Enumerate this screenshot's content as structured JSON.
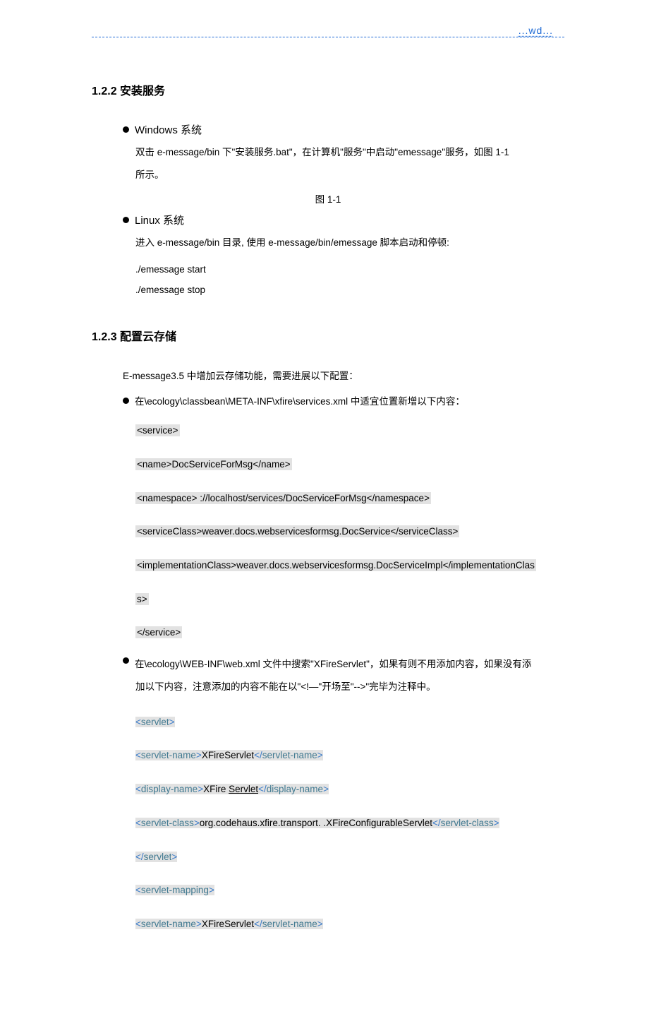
{
  "header": {
    "text": "...wd..."
  },
  "sec1": {
    "heading": "1.2.2 安装服务",
    "win": {
      "title": "Windows 系统",
      "p1": "双击 e-message/bin 下\"安装服务.bat\"，在计算机\"服务\"中启动\"emessage\"服务，如图 1-1",
      "p2": "所示。",
      "fig": "图 1-1"
    },
    "linux": {
      "title": "Linux 系统",
      "p1": "进入 e-message/bin 目录, 使用 e-message/bin/emessage 脚本启动和停顿:",
      "c1": "./emessage   start",
      "c2": "./emessage   stop"
    }
  },
  "sec2": {
    "heading": "1.2.3 配置云存储",
    "intro": "E-message3.5 中增加云存储功能，需要进展以下配置：",
    "bullet1": "在\\ecology\\classbean\\META-INF\\xfire\\services.xml 中适宜位置新增以下内容：",
    "svc": {
      "open": "<service>",
      "name": "  <name>DocServiceForMsg</name>",
      "ns": "  <namespace>       ://localhost/services/DocServiceForMsg</namespace>",
      "scls": "  <serviceClass>weaver.docs.webservicesformsg.DocService</serviceClass>",
      "impl1": "  <implementationClass>weaver.docs.webservicesformsg.DocServiceImpl</implementationClas",
      "impl2": "s>",
      "close": " </service>"
    },
    "bullet2a": "在\\ecology\\WEB-INF\\web.xml 文件中搜索\"XFireServlet\"，如果有则不用添加内容，如果没有添",
    "bullet2b": "加以下内容，注意添加的内容不能在以\"<!—\"开场至\"-->\"完毕为注释中。",
    "xml": {
      "s_open_a": "<",
      "s_open_n": "servlet",
      "s_open_c": ">",
      "sn_open_a": "<",
      "sn_open_n": "servlet-name",
      "sn_open_c": ">",
      "sn_txt": "XFireServlet",
      "sn_cl_a": "</",
      "sn_cl_c": ">",
      "dn_open_a": "<",
      "dn_open_n": "display-name",
      "dn_open_c": ">",
      "dn_txt1": "XFire ",
      "dn_txt2": "Servlet",
      "dn_cl_a": "</",
      "dn_cl_c": ">",
      "sc_open_a": "<",
      "sc_open_n": "servlet-class",
      "sc_open_c": ">",
      "sc_txt": "org.codehaus.xfire.transport.     .XFireConfigurableServlet",
      "sc_cl_a": "</",
      "sc_cl_c": ">",
      "s_cl_a": "</",
      "s_cl_n": "servlet",
      "s_cl_c": ">",
      "sm_open_a": "<",
      "sm_open_n": "servlet-mapping",
      "sm_open_c": ">",
      "sn2_open_a": "<",
      "sn2_txt": "XFireServlet",
      "sn2_cl_a": "</",
      "sn2_cl_c": ">"
    }
  }
}
